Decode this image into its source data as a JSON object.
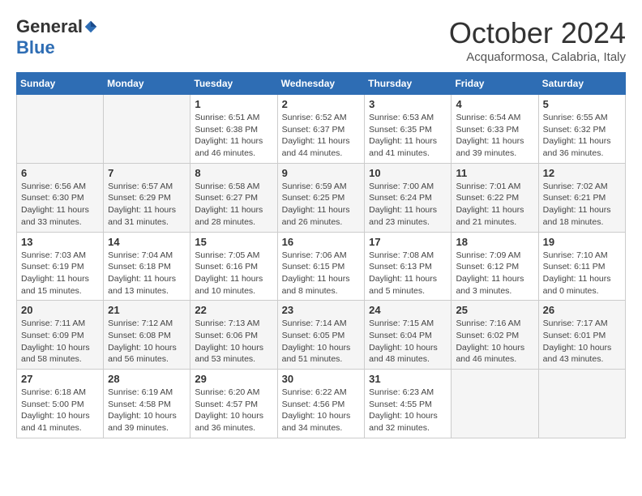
{
  "header": {
    "logo_general": "General",
    "logo_blue": "Blue",
    "month": "October 2024",
    "location": "Acquaformosa, Calabria, Italy"
  },
  "weekdays": [
    "Sunday",
    "Monday",
    "Tuesday",
    "Wednesday",
    "Thursday",
    "Friday",
    "Saturday"
  ],
  "weeks": [
    [
      {
        "day": "",
        "info": ""
      },
      {
        "day": "",
        "info": ""
      },
      {
        "day": "1",
        "info": "Sunrise: 6:51 AM\nSunset: 6:38 PM\nDaylight: 11 hours and 46 minutes."
      },
      {
        "day": "2",
        "info": "Sunrise: 6:52 AM\nSunset: 6:37 PM\nDaylight: 11 hours and 44 minutes."
      },
      {
        "day": "3",
        "info": "Sunrise: 6:53 AM\nSunset: 6:35 PM\nDaylight: 11 hours and 41 minutes."
      },
      {
        "day": "4",
        "info": "Sunrise: 6:54 AM\nSunset: 6:33 PM\nDaylight: 11 hours and 39 minutes."
      },
      {
        "day": "5",
        "info": "Sunrise: 6:55 AM\nSunset: 6:32 PM\nDaylight: 11 hours and 36 minutes."
      }
    ],
    [
      {
        "day": "6",
        "info": "Sunrise: 6:56 AM\nSunset: 6:30 PM\nDaylight: 11 hours and 33 minutes."
      },
      {
        "day": "7",
        "info": "Sunrise: 6:57 AM\nSunset: 6:29 PM\nDaylight: 11 hours and 31 minutes."
      },
      {
        "day": "8",
        "info": "Sunrise: 6:58 AM\nSunset: 6:27 PM\nDaylight: 11 hours and 28 minutes."
      },
      {
        "day": "9",
        "info": "Sunrise: 6:59 AM\nSunset: 6:25 PM\nDaylight: 11 hours and 26 minutes."
      },
      {
        "day": "10",
        "info": "Sunrise: 7:00 AM\nSunset: 6:24 PM\nDaylight: 11 hours and 23 minutes."
      },
      {
        "day": "11",
        "info": "Sunrise: 7:01 AM\nSunset: 6:22 PM\nDaylight: 11 hours and 21 minutes."
      },
      {
        "day": "12",
        "info": "Sunrise: 7:02 AM\nSunset: 6:21 PM\nDaylight: 11 hours and 18 minutes."
      }
    ],
    [
      {
        "day": "13",
        "info": "Sunrise: 7:03 AM\nSunset: 6:19 PM\nDaylight: 11 hours and 15 minutes."
      },
      {
        "day": "14",
        "info": "Sunrise: 7:04 AM\nSunset: 6:18 PM\nDaylight: 11 hours and 13 minutes."
      },
      {
        "day": "15",
        "info": "Sunrise: 7:05 AM\nSunset: 6:16 PM\nDaylight: 11 hours and 10 minutes."
      },
      {
        "day": "16",
        "info": "Sunrise: 7:06 AM\nSunset: 6:15 PM\nDaylight: 11 hours and 8 minutes."
      },
      {
        "day": "17",
        "info": "Sunrise: 7:08 AM\nSunset: 6:13 PM\nDaylight: 11 hours and 5 minutes."
      },
      {
        "day": "18",
        "info": "Sunrise: 7:09 AM\nSunset: 6:12 PM\nDaylight: 11 hours and 3 minutes."
      },
      {
        "day": "19",
        "info": "Sunrise: 7:10 AM\nSunset: 6:11 PM\nDaylight: 11 hours and 0 minutes."
      }
    ],
    [
      {
        "day": "20",
        "info": "Sunrise: 7:11 AM\nSunset: 6:09 PM\nDaylight: 10 hours and 58 minutes."
      },
      {
        "day": "21",
        "info": "Sunrise: 7:12 AM\nSunset: 6:08 PM\nDaylight: 10 hours and 56 minutes."
      },
      {
        "day": "22",
        "info": "Sunrise: 7:13 AM\nSunset: 6:06 PM\nDaylight: 10 hours and 53 minutes."
      },
      {
        "day": "23",
        "info": "Sunrise: 7:14 AM\nSunset: 6:05 PM\nDaylight: 10 hours and 51 minutes."
      },
      {
        "day": "24",
        "info": "Sunrise: 7:15 AM\nSunset: 6:04 PM\nDaylight: 10 hours and 48 minutes."
      },
      {
        "day": "25",
        "info": "Sunrise: 7:16 AM\nSunset: 6:02 PM\nDaylight: 10 hours and 46 minutes."
      },
      {
        "day": "26",
        "info": "Sunrise: 7:17 AM\nSunset: 6:01 PM\nDaylight: 10 hours and 43 minutes."
      }
    ],
    [
      {
        "day": "27",
        "info": "Sunrise: 6:18 AM\nSunset: 5:00 PM\nDaylight: 10 hours and 41 minutes."
      },
      {
        "day": "28",
        "info": "Sunrise: 6:19 AM\nSunset: 4:58 PM\nDaylight: 10 hours and 39 minutes."
      },
      {
        "day": "29",
        "info": "Sunrise: 6:20 AM\nSunset: 4:57 PM\nDaylight: 10 hours and 36 minutes."
      },
      {
        "day": "30",
        "info": "Sunrise: 6:22 AM\nSunset: 4:56 PM\nDaylight: 10 hours and 34 minutes."
      },
      {
        "day": "31",
        "info": "Sunrise: 6:23 AM\nSunset: 4:55 PM\nDaylight: 10 hours and 32 minutes."
      },
      {
        "day": "",
        "info": ""
      },
      {
        "day": "",
        "info": ""
      }
    ]
  ]
}
